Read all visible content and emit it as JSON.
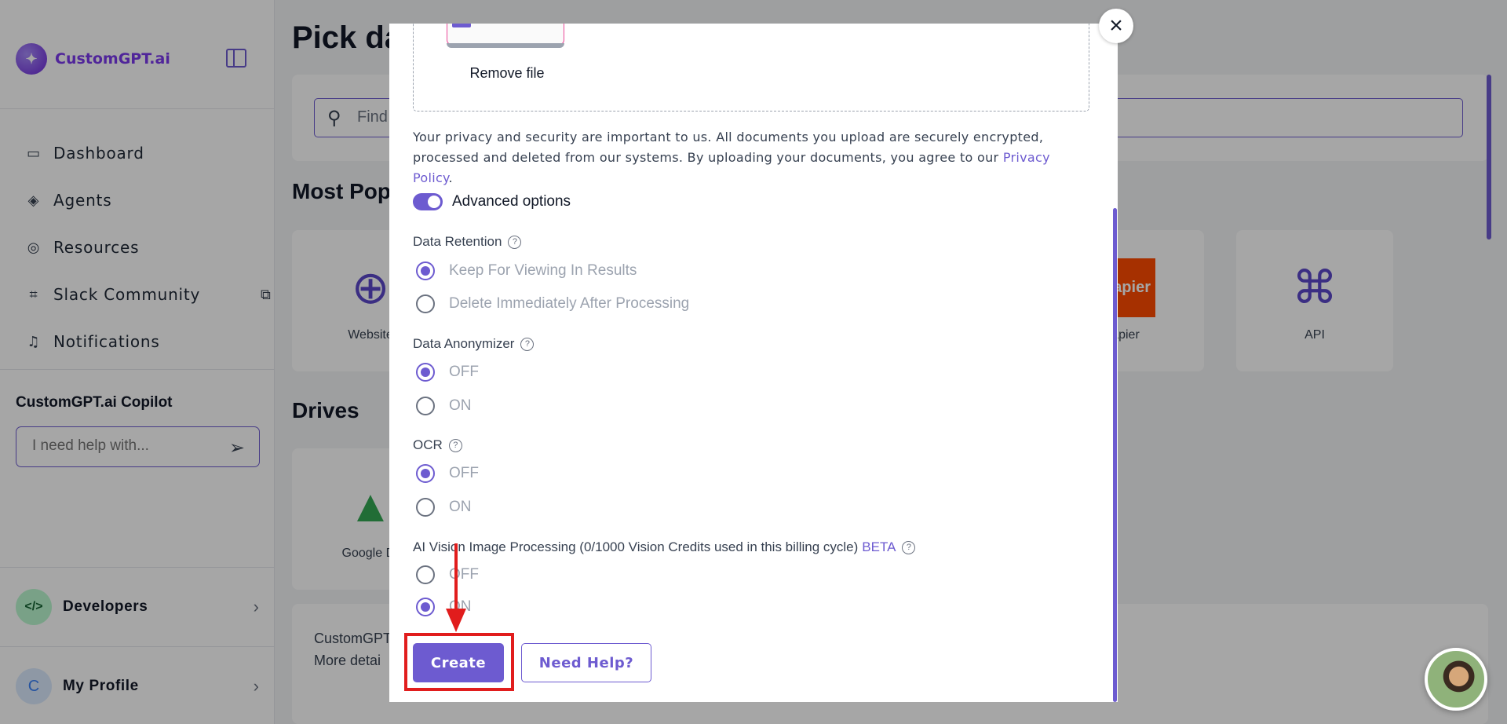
{
  "sidebar": {
    "logo_text": "CustomGPT.ai",
    "nav": [
      {
        "label": "Dashboard",
        "icon": "monitor-icon"
      },
      {
        "label": "Agents",
        "icon": "layers-icon"
      },
      {
        "label": "Resources",
        "icon": "lifebuoy-icon"
      },
      {
        "label": "Slack Community",
        "icon": "slack-icon"
      },
      {
        "label": "Notifications",
        "icon": "bell-icon"
      }
    ],
    "copilot_title": "CustomGPT.ai Copilot",
    "copilot_placeholder": "I need help with...",
    "developers_label": "Developers",
    "profile_label": "My Profile",
    "profile_initial": "C"
  },
  "main": {
    "title": "Pick da",
    "search_placeholder": "Find",
    "most_popular": "Most Popu",
    "drives": "Drives",
    "tiles": {
      "website": "Website",
      "zapier": "apier",
      "zapier_logo": "apier",
      "api": "API",
      "google_drive": "Google Dr"
    },
    "bottom_line1": "CustomGPT",
    "bottom_line2": "More detai"
  },
  "modal": {
    "remove_file": "Remove file",
    "privacy_text": "Your privacy and security are important to us. All documents you upload are securely encrypted, processed and deleted from our systems. By uploading your documents, you agree to our ",
    "privacy_link": "Privacy Policy",
    "privacy_end": ".",
    "advanced_options": "Advanced options",
    "groups": {
      "retention": {
        "label": "Data Retention",
        "opt1": "Keep For Viewing In Results",
        "opt2": "Delete Immediately After Processing",
        "selected": "Keep For Viewing In Results"
      },
      "anonymizer": {
        "label": "Data Anonymizer",
        "opt1": "OFF",
        "opt2": "ON",
        "selected": "OFF"
      },
      "ocr": {
        "label": "OCR",
        "opt1": "OFF",
        "opt2": "ON",
        "selected": "OFF"
      },
      "vision": {
        "label": "AI Vision Image Processing (0/1000 Vision Credits used in this billing cycle)",
        "beta": "BETA",
        "opt1": "OFF",
        "opt2": "ON",
        "selected": "ON"
      }
    },
    "create_label": "Create",
    "help_label": "Need Help?",
    "close_icon": "×"
  },
  "colors": {
    "accent": "#6d5bd0",
    "annotation": "#e11d1d"
  }
}
